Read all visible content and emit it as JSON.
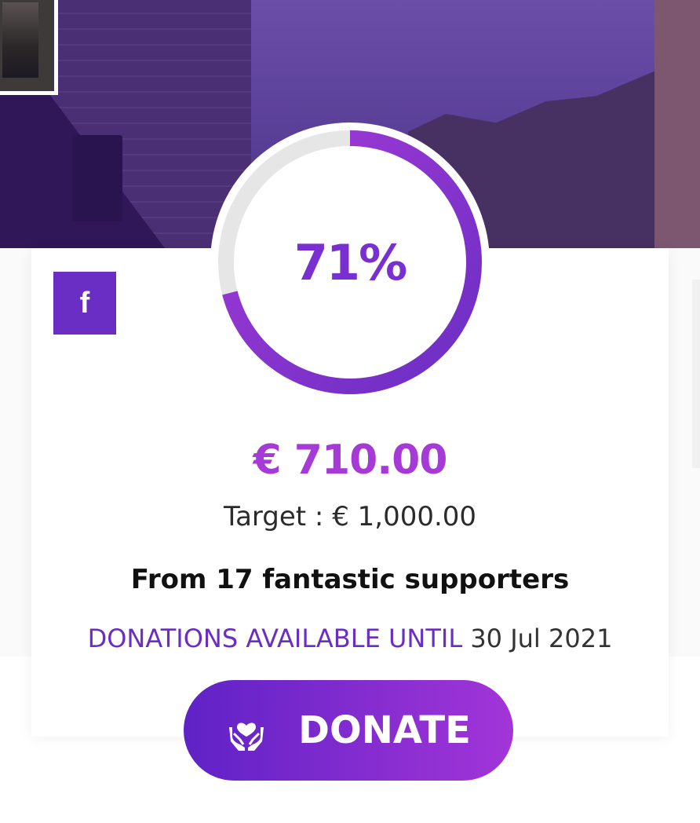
{
  "progress": {
    "percent_label": "71%",
    "fraction": 0.71,
    "track_color": "#e6e6e6",
    "gradient_start": "#6a2ec4",
    "gradient_end": "#a53ad6"
  },
  "amounts": {
    "raised": "€ 710.00",
    "target": "Target : € 1,000.00"
  },
  "supporters_text": "From 17 fantastic supporters",
  "deadline": {
    "label": "DONATIONS AVAILABLE UNTIL",
    "date": "30 Jul 2021"
  },
  "donate": {
    "label": "DONATE",
    "icon": "hands-heart-icon"
  },
  "share": {
    "facebook_glyph": "f",
    "icon": "facebook-icon"
  },
  "colors": {
    "brand_purple": "#6a2ec4",
    "accent_magenta": "#a53ad6"
  }
}
